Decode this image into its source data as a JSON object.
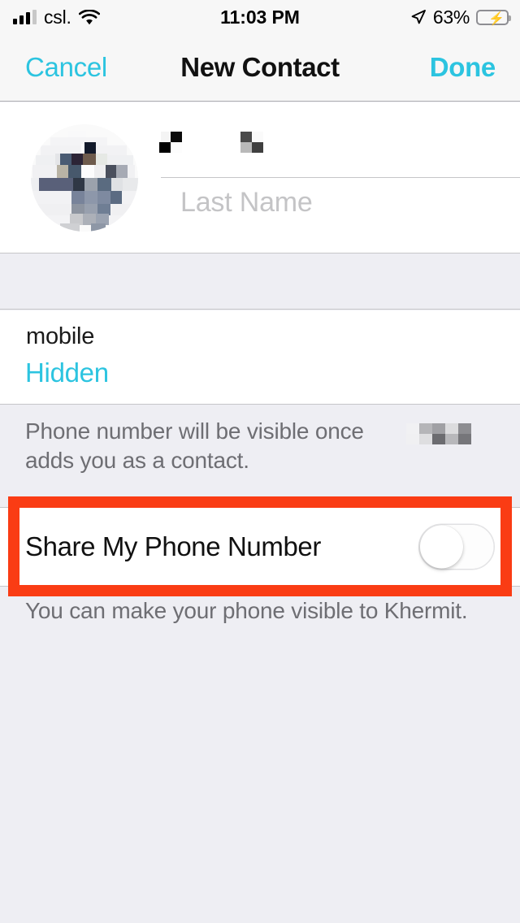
{
  "status_bar": {
    "carrier": "csl.",
    "signal_bars": 3,
    "signal_bars_total": 4,
    "wifi_icon": "wifi-icon",
    "time": "11:03 PM",
    "location_icon": "location-arrow-icon",
    "battery_percent": "63%",
    "battery_level": 63,
    "battery_charging": true,
    "battery_charging_icon": "lightning-bolt-icon"
  },
  "nav_bar": {
    "cancel_label": "Cancel",
    "title": "New Contact",
    "done_label": "Done"
  },
  "name_section": {
    "avatar_name": "contact-avatar",
    "avatar_redacted": true,
    "first_name_value": "",
    "first_name_redacted": true,
    "last_name_placeholder": "Last Name"
  },
  "phone_section": {
    "label": "mobile",
    "value": "Hidden"
  },
  "note_visibility": {
    "line1": "Phone number will be visible once",
    "line2": "adds you as a contact.",
    "redacted_name": true
  },
  "share_row": {
    "label": "Share My Phone Number",
    "toggle_state": "off",
    "highlighted": true
  },
  "note_share": {
    "text": "You can make your phone visible to Khermit."
  },
  "colors": {
    "accent_cyan": "#2cc4e0",
    "highlight_red": "#fa3c14",
    "page_background": "#eeeef3",
    "card_background": "#ffffff",
    "bar_background": "#f7f7f7",
    "secondary_text": "#6e6e73",
    "placeholder_text": "#c4c4c6",
    "battery_green": "#4cd562"
  }
}
